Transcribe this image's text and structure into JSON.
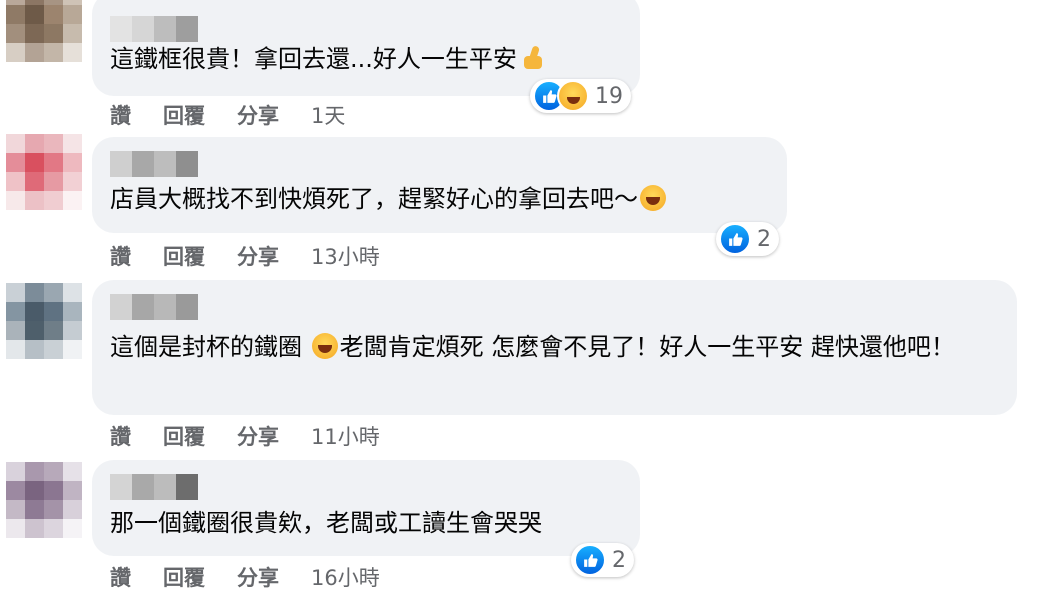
{
  "comments": [
    {
      "text_parts": [
        "這鐵框很貴！拿回去還...好人一生平安",
        ""
      ],
      "emoji": "thumbs-up-emoji",
      "reaction_count": "19",
      "time": "1天"
    },
    {
      "text_parts": [
        "店員大概找不到快煩死了，趕緊好心的拿回去吧～",
        ""
      ],
      "emoji": "rolling-laughing-emoji",
      "reaction_count": "2",
      "time": "13小時"
    },
    {
      "text_parts": [
        "這個是封杯的鐵圈",
        "老闆肯定煩死 怎麼會不見了！好人一生平安 趕快還他吧！"
      ],
      "emoji": "rolling-laughing-emoji",
      "reaction_count": null,
      "time": "11小時"
    },
    {
      "text_parts": [
        "那一個鐵圈很貴欸，老闆或工讀生會哭哭",
        ""
      ],
      "emoji": null,
      "reaction_count": "2",
      "time": "16小時"
    }
  ],
  "actions": {
    "like_label": "讚",
    "reply_label": "回覆",
    "share_label": "分享"
  },
  "colors": {
    "bubble_bg": "#f0f2f5",
    "meta_text": "#65676b",
    "like_blue": "#1877f2"
  }
}
